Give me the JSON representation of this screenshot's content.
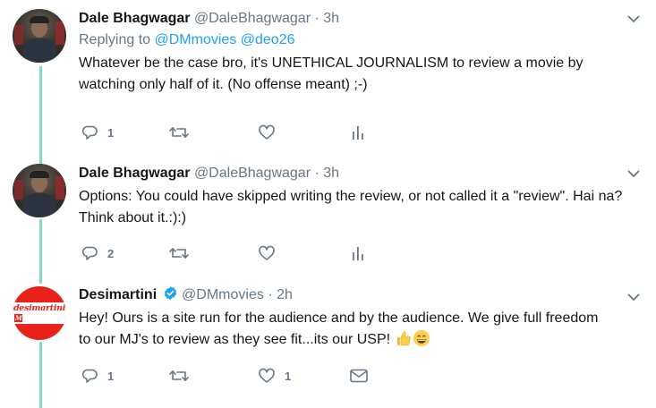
{
  "tweets": [
    {
      "name": "Dale Bhagwagar",
      "handle": "@DaleBhagwagar",
      "dot": "·",
      "time": "3h",
      "replying_prefix": "Replying to",
      "replying_mentions": [
        "@DMmovies",
        "@deo26"
      ],
      "text": "Whatever be the case bro, it's UNETHICAL JOURNALISM to review a movie by watching only half of it. (No offense meant) ;-)",
      "reply_count": "1",
      "retweet_count": "",
      "like_count": ""
    },
    {
      "name": "Dale Bhagwagar",
      "handle": "@DaleBhagwagar",
      "dot": "·",
      "time": "3h",
      "text": "Options: You could have skipped writing the review, or not called it a \"review\". Hai na? Think about it.:):)",
      "reply_count": "2",
      "retweet_count": "",
      "like_count": ""
    },
    {
      "name": "Desimartini",
      "handle": "@DMmovies",
      "dot": "·",
      "time": "2h",
      "verified": true,
      "avatar_logo": "desimartini",
      "text_line1": "Hey! Ours is a site run for the audience and by the audience. We give full freedom",
      "text_line2": "to our MJ's  to review as they see fit...its our USP!",
      "reply_count": "1",
      "retweet_count": "",
      "like_count": "1"
    }
  ],
  "colors": {
    "thread_line": "#7fdec0",
    "link": "#1da1f2",
    "muted": "#657786",
    "brand_red": "#e8221b"
  },
  "icons": [
    "reply-icon",
    "retweet-icon",
    "like-icon",
    "analytics-icon",
    "direct-message-icon",
    "caret-down-icon",
    "verified-icon"
  ]
}
